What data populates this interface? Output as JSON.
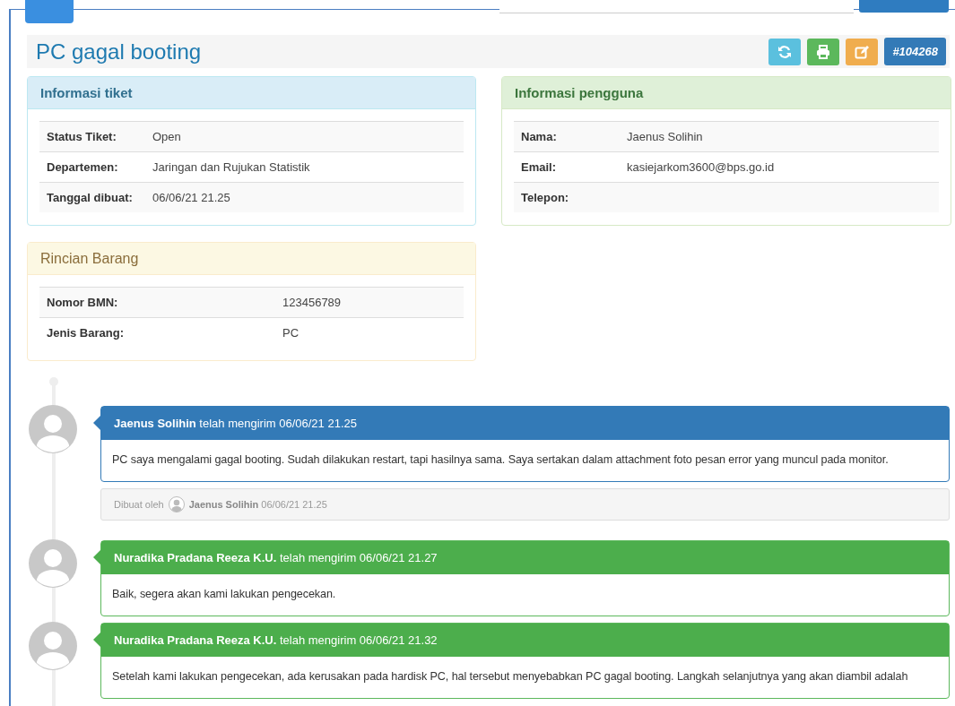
{
  "title": "PC gagal booting",
  "actions": [
    {
      "kind": "refresh"
    },
    {
      "kind": "print"
    },
    {
      "kind": "edit"
    }
  ],
  "ticket_id": "#104268",
  "panels": [
    {
      "kind": "info",
      "title": "Informasi tiket",
      "rows": [
        {
          "label": "Status Tiket:",
          "value": "Open"
        },
        {
          "label": "Departemen:",
          "value": "Jaringan dan Rujukan Statistik"
        },
        {
          "label": "Tanggal dibuat:",
          "value": "06/06/21 21.25"
        }
      ]
    },
    {
      "kind": "success",
      "title": "Informasi pengguna",
      "rows": [
        {
          "label": "Nama:",
          "value": "Jaenus Solihin"
        },
        {
          "label": "Email:",
          "value": "kasiejarkom3600@bps.go.id"
        },
        {
          "label": "Telepon:",
          "value": ""
        }
      ]
    },
    {
      "kind": "warning",
      "title": "Rincian Barang",
      "rows": [
        {
          "label": "Nomor BMN:",
          "value": "123456789"
        },
        {
          "label": "Jenis Barang:",
          "value": "PC"
        }
      ]
    }
  ],
  "messages": [
    {
      "kind": "primary",
      "author": "Jaenus Solihin",
      "action": "telah mengirim 06/06/21 21.25",
      "body": "PC saya mengalami gagal booting. Sudah dilakukan restart, tapi hasilnya sama. Saya sertakan dalam attachment foto pesan error yang muncul pada monitor.",
      "footer": {
        "prefix": "Dibuat oleh",
        "author": "Jaenus Solihin",
        "time": "06/06/21 21.25"
      }
    },
    {
      "kind": "success",
      "author": "Nuradika Pradana Reeza K.U.",
      "action": "telah mengirim 06/06/21 21.27",
      "body": "Baik, segera akan kami lakukan pengecekan."
    },
    {
      "kind": "success",
      "author": "Nuradika Pradana Reeza K.U.",
      "action": "telah mengirim 06/06/21 21.32",
      "body": "Setelah kami lakukan pengecekan, ada kerusakan pada hardisk PC, hal tersebut menyebabkan PC gagal booting. Langkah selanjutnya yang akan diambil adalah"
    }
  ]
}
